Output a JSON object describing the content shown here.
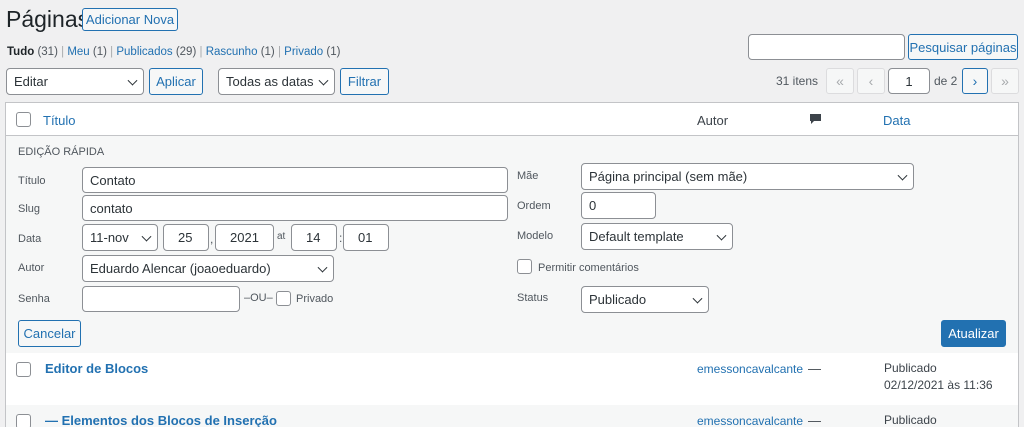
{
  "header": {
    "title": "Páginas",
    "add_new_label": "Adicionar Nova"
  },
  "filters": {
    "views": [
      {
        "label": "Tudo",
        "count": "(31)"
      },
      {
        "label": "Meu",
        "count": "(1)"
      },
      {
        "label": "Publicados",
        "count": "(29)"
      },
      {
        "label": "Rascunho",
        "count": "(1)"
      },
      {
        "label": "Privado",
        "count": "(1)"
      }
    ],
    "separator": "|"
  },
  "search": {
    "value": "",
    "button_label": "Pesquisar páginas"
  },
  "bulk": {
    "action_value": "Editar",
    "apply_label": "Aplicar",
    "date_value": "Todas as datas",
    "filter_label": "Filtrar"
  },
  "pagination": {
    "items_count": "31 itens",
    "first": "«",
    "prev": "‹",
    "current": "1",
    "of_total": "de 2",
    "next": "›",
    "last": "»"
  },
  "table": {
    "col_title": "Título",
    "col_author": "Autor",
    "col_date": "Data"
  },
  "quick_edit": {
    "heading": "EDIÇÃO RÁPIDA",
    "title_label": "Título",
    "title_value": "Contato",
    "slug_label": "Slug",
    "slug_value": "contato",
    "date_label": "Data",
    "month_value": "11-nov",
    "day_value": "25",
    "comma": ",",
    "year_value": "2021",
    "at_label": "at",
    "hour_value": "14",
    "colon": ":",
    "minute_value": "01",
    "author_label": "Autor",
    "author_value": "Eduardo Alencar (joaoeduardo)",
    "password_label": "Senha",
    "password_value": "",
    "or_label": "–OU–",
    "private_label": "Privado",
    "parent_label": "Mãe",
    "parent_value": "Página principal (sem mãe)",
    "order_label": "Ordem",
    "order_value": "0",
    "template_label": "Modelo",
    "template_value": "Default template",
    "allow_comments_label": "Permitir comentários",
    "status_label": "Status",
    "status_value": "Publicado",
    "cancel_label": "Cancelar",
    "update_label": "Atualizar"
  },
  "rows": [
    {
      "title": "Editor de Blocos",
      "author": "emessoncavalcante",
      "comments": "—",
      "status": "Publicado",
      "date": "02/12/2021 às 11:36"
    },
    {
      "title": "— Elementos dos Blocos de Inserção",
      "author": "emessoncavalcante",
      "comments": "—",
      "status": "Publicado",
      "date": ""
    }
  ]
}
